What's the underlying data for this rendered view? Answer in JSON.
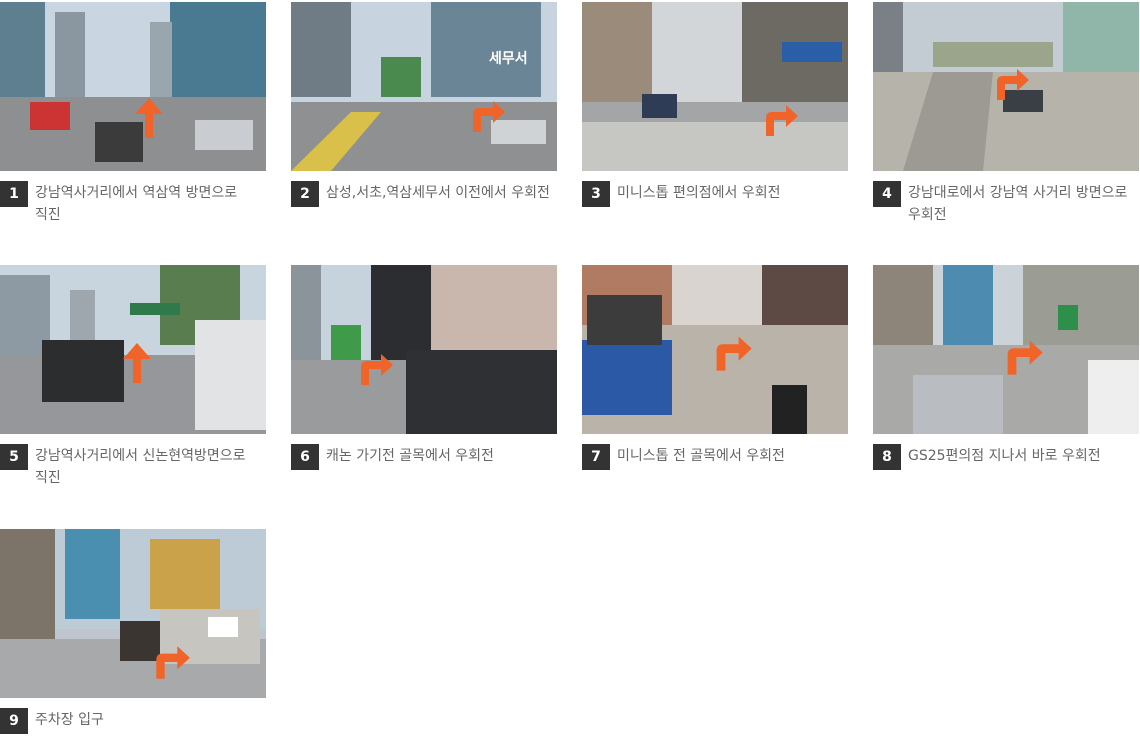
{
  "steps": [
    {
      "number": "1",
      "caption": "강남역사거리에서 역삼역 방면으로 직진",
      "icon": "arrow-up-icon"
    },
    {
      "number": "2",
      "caption": "삼성,서초,역삼세무서 이전에서 우회전",
      "icon": "arrow-right-turn-icon",
      "sign": "세무서"
    },
    {
      "number": "3",
      "caption": "미니스톱 편의점에서 우회전",
      "icon": "arrow-right-turn-icon"
    },
    {
      "number": "4",
      "caption": "강남대로에서 강남역 사거리 방면으로 우회전",
      "icon": "arrow-right-turn-icon"
    },
    {
      "number": "5",
      "caption": "강남역사거리에서 신논현역방면으로 직진",
      "icon": "arrow-up-icon"
    },
    {
      "number": "6",
      "caption": "캐논 가기전 골목에서 우회전",
      "icon": "arrow-right-turn-icon"
    },
    {
      "number": "7",
      "caption": "미니스톱 전 골목에서 우회전",
      "icon": "arrow-right-turn-icon"
    },
    {
      "number": "8",
      "caption": "GS25편의점 지나서 바로 우회전",
      "icon": "arrow-right-turn-icon"
    },
    {
      "number": "9",
      "caption": "주차장 입구",
      "icon": "arrow-right-turn-icon"
    }
  ],
  "colors": {
    "arrow": "#f0642a",
    "badge": "#333333",
    "caption": "#666666"
  }
}
